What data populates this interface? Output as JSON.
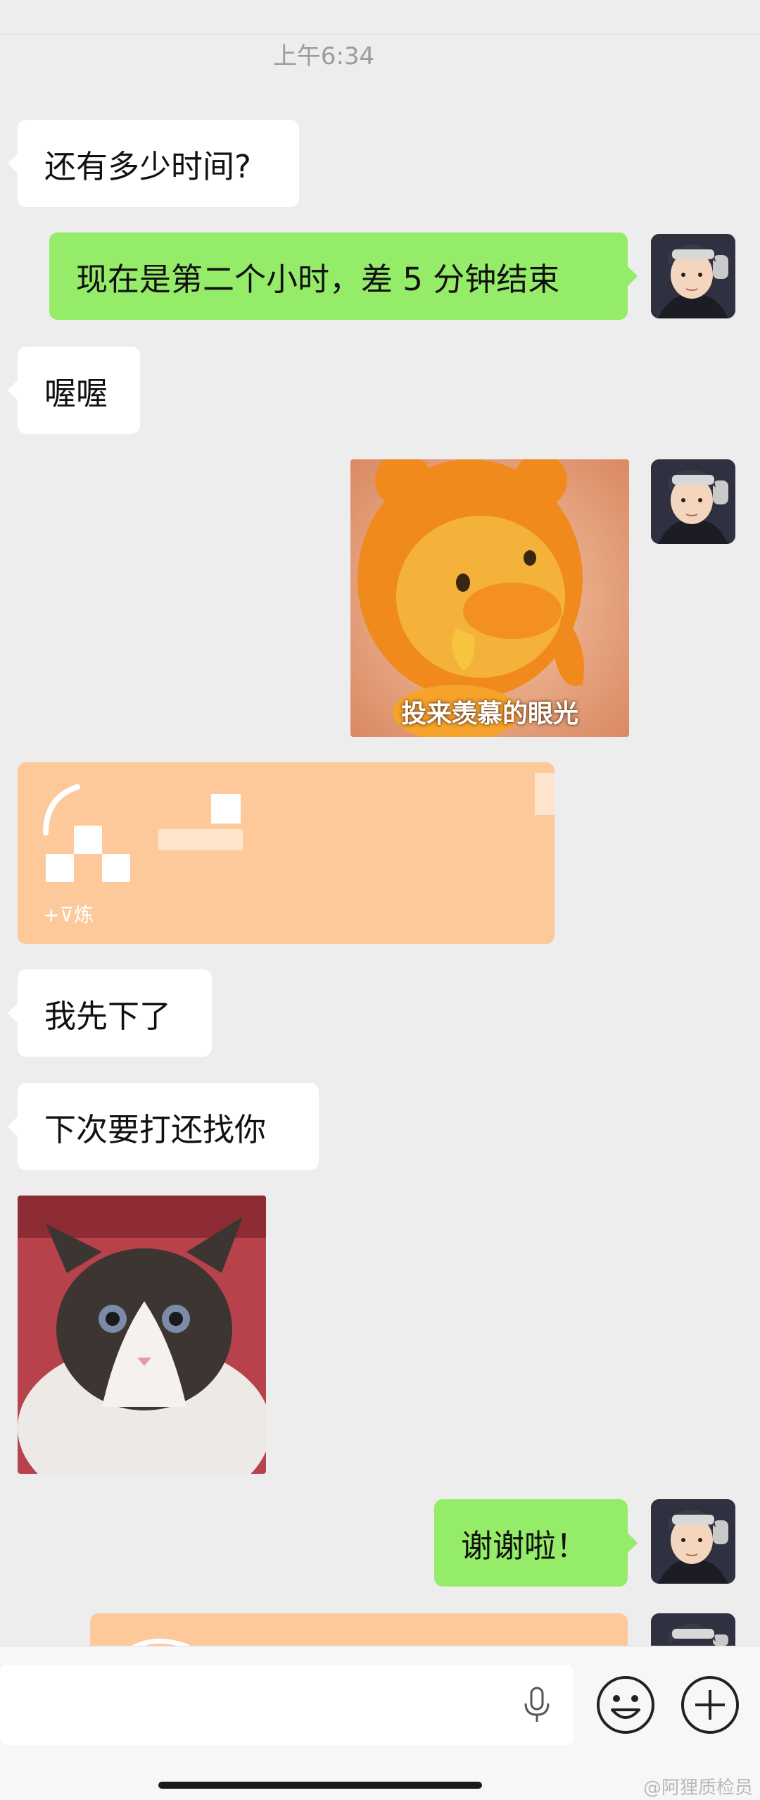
{
  "timestamp": "上午6:34",
  "messages": {
    "m1": "还有多少时间?",
    "m2": "现在是第二个小时，差 5 分钟结束",
    "m3": "喔喔",
    "sticker_caption": "投来羡慕的眼光",
    "card_label": "+⊽炼",
    "m5": "我先下了",
    "m6": "下次要打还找你",
    "m8": "谢谢啦！"
  },
  "watermark": "@阿狸质检员",
  "icons": {
    "voice": "microphone-icon",
    "emoji": "smiley-icon",
    "more": "plus-icon"
  },
  "colors": {
    "background": "#ededed",
    "outgoing_bubble": "#95ec69",
    "incoming_bubble": "#ffffff",
    "card": "#fdc99a"
  }
}
